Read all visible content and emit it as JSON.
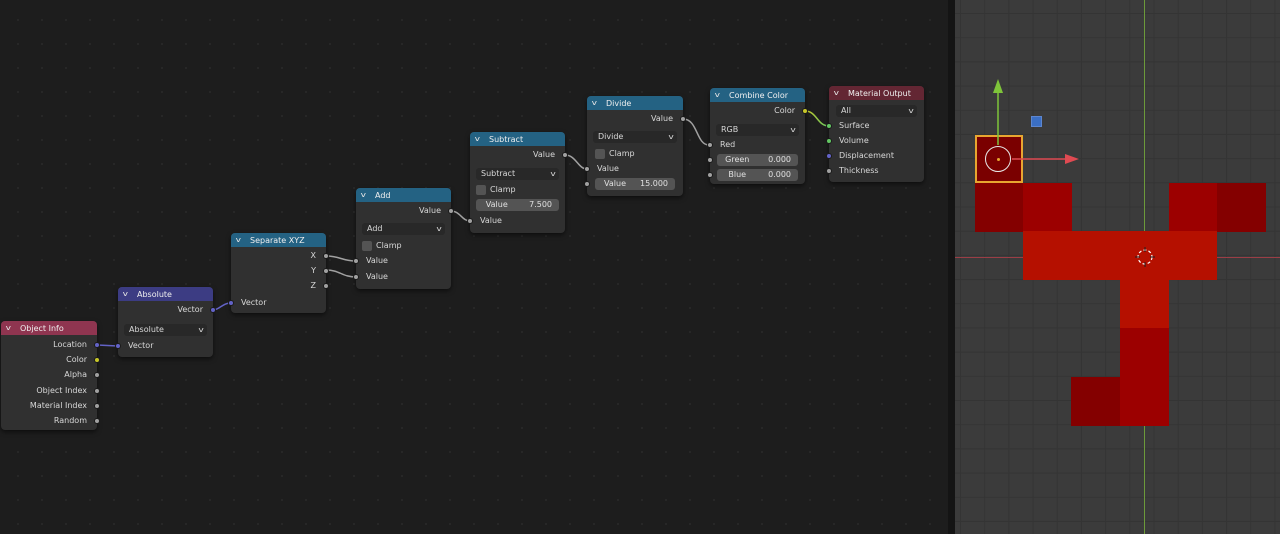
{
  "colors": {
    "editor_bg": "#1d1d1d",
    "node_body": "#303030",
    "header_input": "#8f3550",
    "header_converter": "#246283",
    "header_vector": "#3c3c83",
    "header_output": "#632633",
    "socket_float": "#a1a1a1",
    "socket_vector": "#6363c7",
    "socket_color": "#c7c729",
    "socket_shader": "#63c763",
    "object_red": "#b51000",
    "selection_outline": "#e8a630"
  },
  "nodes": {
    "object_info": {
      "title": "Object Info",
      "outputs": [
        "Location",
        "Color",
        "Alpha",
        "Object Index",
        "Material Index",
        "Random"
      ]
    },
    "absolute": {
      "title": "Absolute",
      "output": "Vector",
      "operation": "Absolute",
      "input": "Vector"
    },
    "separate_xyz": {
      "title": "Separate XYZ",
      "outputs": [
        "X",
        "Y",
        "Z"
      ],
      "input": "Vector"
    },
    "add": {
      "title": "Add",
      "output": "Value",
      "operation": "Add",
      "clamp_label": "Clamp",
      "inputs": [
        "Value",
        "Value"
      ]
    },
    "subtract": {
      "title": "Subtract",
      "output": "Value",
      "operation": "Subtract",
      "clamp_label": "Clamp",
      "input": "Value",
      "field_label": "Value",
      "field_value": "7.500"
    },
    "divide": {
      "title": "Divide",
      "output": "Value",
      "operation": "Divide",
      "clamp_label": "Clamp",
      "input": "Value",
      "field_label": "Value",
      "field_value": "15.000"
    },
    "combine_color": {
      "title": "Combine Color",
      "output": "Color",
      "mode": "RGB",
      "input_red": "Red",
      "green_label": "Green",
      "green_value": "0.000",
      "blue_label": "Blue",
      "blue_value": "0.000"
    },
    "material_output": {
      "title": "Material Output",
      "target": "All",
      "inputs": [
        "Surface",
        "Volume",
        "Displacement",
        "Thickness"
      ]
    }
  },
  "icons": {
    "collapse": "chevron-down-icon",
    "dropdown": "chevron-down-icon",
    "origin": "object-origin-icon",
    "cursor": "3d-cursor-icon"
  }
}
